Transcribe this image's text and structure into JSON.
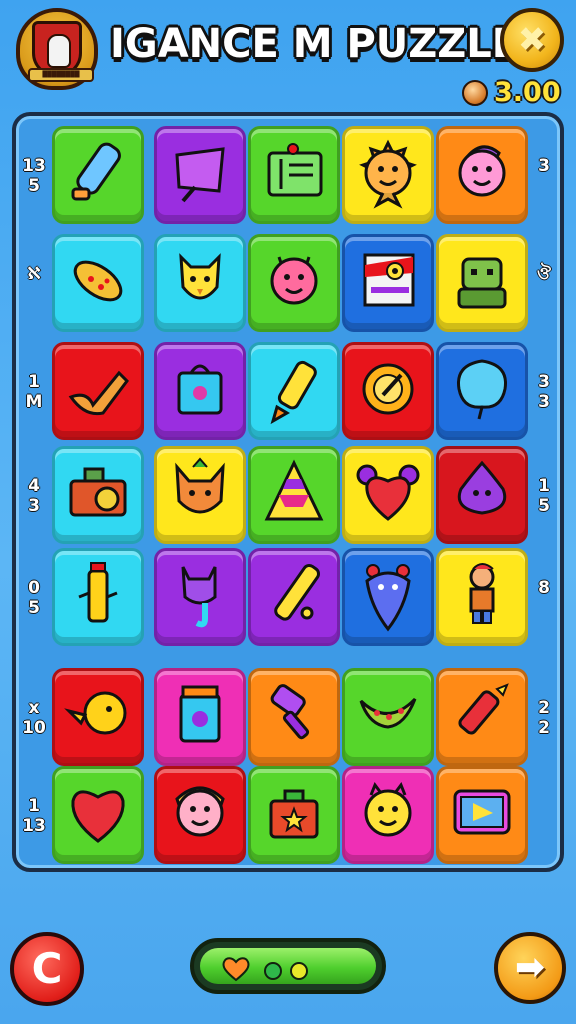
{
  "header": {
    "title": "IGANCE M PUZZLE",
    "balance": "3.00",
    "crest_ribbon": "████████"
  },
  "board": {
    "rows": [
      {
        "left": "1​3\n5",
        "right": "3",
        "tiles": [
          {
            "color": "#56d62b",
            "icon": "tube-icon"
          },
          {
            "color": "#9a2ee0",
            "icon": "bag-icon"
          },
          {
            "color": "#56d62b",
            "icon": "ticket-icon"
          },
          {
            "color": "#ffe71c",
            "icon": "sun-creature-icon"
          },
          {
            "color": "#ff8a16",
            "icon": "genie-icon"
          }
        ]
      },
      {
        "left": "ℵ",
        "right": "ঔ",
        "tiles": [
          {
            "color": "#31d8f2",
            "icon": "fish-icon"
          },
          {
            "color": "#31d8f2",
            "icon": "cat-face-icon"
          },
          {
            "color": "#56d62b",
            "icon": "pink-monster-icon"
          },
          {
            "color": "#1f6fe0",
            "icon": "flag-eye-icon"
          },
          {
            "color": "#ffe71c",
            "icon": "robot-icon"
          }
        ]
      },
      {
        "left": "1\nM",
        "right": "3\n3",
        "tiles": [
          {
            "color": "#e8141b",
            "icon": "flame-hand-icon"
          },
          {
            "color": "#9a2ee0",
            "icon": "box-icon"
          },
          {
            "color": "#31d8f2",
            "icon": "crayon-icon"
          },
          {
            "color": "#e8141b",
            "icon": "sunburst-icon"
          },
          {
            "color": "#1f6fe0",
            "icon": "balloon-icon"
          }
        ]
      },
      {
        "left": "4\n3",
        "right": "1\n5",
        "tiles": [
          {
            "color": "#31d8f2",
            "icon": "camera-icon"
          },
          {
            "color": "#ffe71c",
            "icon": "fox-icon"
          },
          {
            "color": "#56d62b",
            "icon": "pyramid-icon"
          },
          {
            "color": "#ffe71c",
            "icon": "heart-pigtails-icon"
          },
          {
            "color": "#d8161e",
            "icon": "purple-blob-icon"
          }
        ]
      },
      {
        "left": "0\n5",
        "right": "8",
        "tiles": [
          {
            "color": "#31d8f2",
            "icon": "yellow-bottle-icon"
          },
          {
            "color": "#9a2ee0",
            "icon": "purple-cat-icon"
          },
          {
            "color": "#9a2ee0",
            "icon": "knife-icon"
          },
          {
            "color": "#1f6fe0",
            "icon": "drop-creature-icon"
          },
          {
            "color": "#ffe71c",
            "icon": "kid-icon"
          }
        ]
      },
      {
        "left": "x\n10",
        "right": "2\n2",
        "tiles": [
          {
            "color": "#e8141b",
            "icon": "yellow-bird-icon"
          },
          {
            "color": "#ef2fb5",
            "icon": "jar-icon"
          },
          {
            "color": "#ff8a16",
            "icon": "purple-roller-icon"
          },
          {
            "color": "#56d62b",
            "icon": "pea-pod-icon"
          },
          {
            "color": "#ff8a16",
            "icon": "red-crayon-icon"
          }
        ]
      },
      {
        "left": "1\n13",
        "right": "",
        "tiles": [
          {
            "color": "#56d62b",
            "icon": "heart-icon"
          },
          {
            "color": "#e8141b",
            "icon": "girl-face-icon"
          },
          {
            "color": "#56d62b",
            "icon": "star-box-icon"
          },
          {
            "color": "#ef2fb5",
            "icon": "smiley-icon"
          },
          {
            "color": "#ff8a16",
            "icon": "tv-icon"
          }
        ]
      }
    ]
  },
  "footer": {
    "undo_icon": "undo-icon",
    "next_icon": "arrow-right-icon",
    "progress_dots": [
      "#ff8a2a",
      "#2fb84a",
      "#e8e82a"
    ]
  }
}
